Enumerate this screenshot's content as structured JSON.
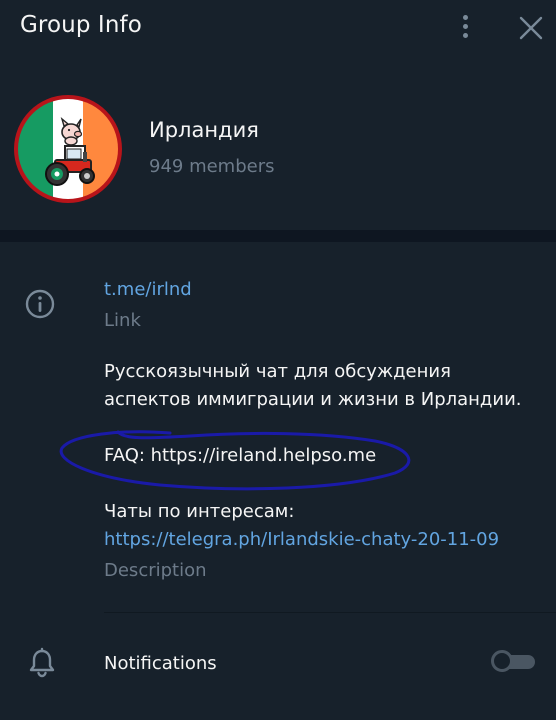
{
  "header": {
    "title": "Group Info",
    "menu_icon": "more-vertical-icon",
    "close_icon": "close-icon"
  },
  "group": {
    "name": "Ирландия",
    "members": "949 members",
    "avatar_icon": "ireland-flag-tractor-avatar"
  },
  "info": {
    "icon": "info-icon",
    "link_value": "t.me/irlnd",
    "link_caption": "Link",
    "description_lines": [
      "Русскоязычный чат для обсуждения",
      "аспектов иммиграции и жизни в Ирландии.",
      "FAQ: https://ireland.helpso.me",
      "Чаты по интересам:"
    ],
    "description_link": "https://telegra.ph/Irlandskie-chaty-20-11-09",
    "description_caption": "Description"
  },
  "notifications": {
    "icon": "bell-icon",
    "label": "Notifications",
    "enabled": false
  },
  "colors": {
    "background": "#17212b",
    "separator": "#0e1621",
    "text": "#f5f5f5",
    "secondary_text": "#6d7b8a",
    "link": "#62a5e1",
    "annotation": "#1a1aa8",
    "flag_green": "#169b62",
    "flag_orange": "#ff883e",
    "avatar_ring": "#b8141a"
  }
}
